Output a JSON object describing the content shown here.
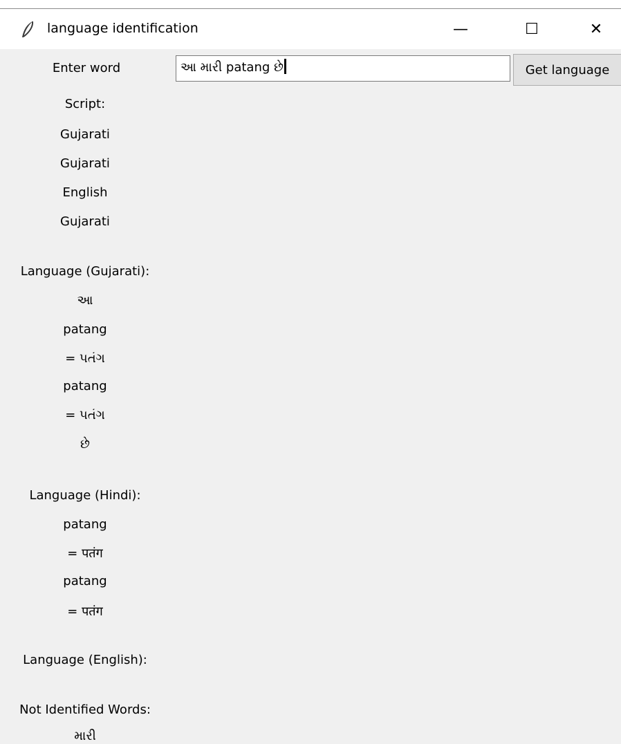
{
  "window": {
    "title": "language identification",
    "minimize_glyph": "—",
    "maximize_glyph": "☐",
    "close_glyph": "✕"
  },
  "form": {
    "enter_label": "Enter word",
    "input_value": "આ મારી patang છે",
    "button_label": "Get language"
  },
  "script_section": {
    "heading": "Script:",
    "items": [
      "Gujarati",
      "Gujarati",
      "English",
      "Gujarati"
    ]
  },
  "gujarati_section": {
    "heading": "Language (Gujarati):",
    "items": [
      "આ",
      "patang",
      "= પતંગ",
      "patang",
      "= પતંગ",
      "છે"
    ]
  },
  "hindi_section": {
    "heading": "Language (Hindi):",
    "items": [
      "patang",
      "= पतंग",
      "patang",
      "= पतंग"
    ]
  },
  "english_section": {
    "heading": "Language (English):"
  },
  "unidentified_section": {
    "heading": "Not Identified Words:",
    "items": [
      "મારી"
    ]
  }
}
